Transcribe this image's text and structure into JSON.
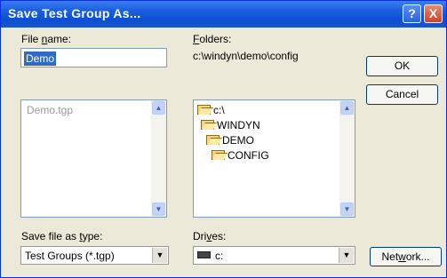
{
  "window": {
    "title": "Save Test Group As..."
  },
  "titlebar_buttons": {
    "help": "?",
    "close": "X"
  },
  "file_name": {
    "label_pre": "File ",
    "label_u": "n",
    "label_post": "ame:",
    "value": "Demo",
    "list": [
      "Demo.tgp"
    ]
  },
  "folders": {
    "label_u": "F",
    "label_post": "olders:",
    "path": "c:\\windyn\\demo\\config",
    "tree": [
      "c:\\",
      "WINDYN",
      "DEMO",
      "CONFIG"
    ]
  },
  "buttons": {
    "ok": "OK",
    "cancel": "Cancel",
    "network_pre": "Net",
    "network_u": "w",
    "network_post": "ork..."
  },
  "save_type": {
    "label_pre": "Save file as ",
    "label_u": "t",
    "label_post": "ype:",
    "value": "Test Groups (*.tgp)"
  },
  "drives": {
    "label_pre": "Dri",
    "label_u": "v",
    "label_post": "es:",
    "value": "c:"
  },
  "icons": {
    "help": "question-mark-icon",
    "close": "close-icon",
    "folder": "folder-open-icon",
    "drive": "drive-icon",
    "dropdown": "chevron-down-icon"
  }
}
